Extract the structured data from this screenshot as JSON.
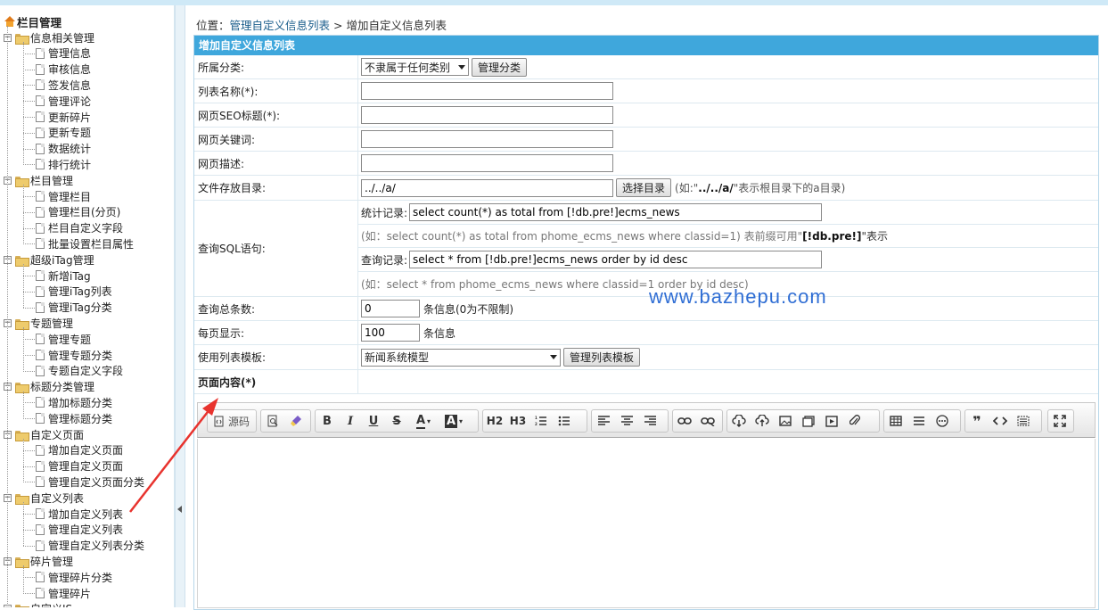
{
  "sidebar": {
    "root": "栏目管理",
    "groups": [
      {
        "label": "信息相关管理",
        "items": [
          "管理信息",
          "审核信息",
          "签发信息",
          "管理评论",
          "更新碎片",
          "更新专题",
          "数据统计",
          "排行统计"
        ]
      },
      {
        "label": "栏目管理",
        "items": [
          "管理栏目",
          "管理栏目(分页)",
          "栏目自定义字段",
          "批量设置栏目属性"
        ]
      },
      {
        "label": "超级iTag管理",
        "items": [
          "新增iTag",
          "管理iTag列表",
          "管理iTag分类"
        ]
      },
      {
        "label": "专题管理",
        "items": [
          "管理专题",
          "管理专题分类",
          "专题自定义字段"
        ]
      },
      {
        "label": "标题分类管理",
        "items": [
          "增加标题分类",
          "管理标题分类"
        ]
      },
      {
        "label": "自定义页面",
        "items": [
          "增加自定义页面",
          "管理自定义页面",
          "管理自定义页面分类"
        ]
      },
      {
        "label": "自定义列表",
        "items": [
          "增加自定义列表",
          "管理自定义列表",
          "管理自定义列表分类"
        ]
      },
      {
        "label": "碎片管理",
        "items": [
          "管理碎片分类",
          "管理碎片"
        ]
      }
    ],
    "cut_label": "自定义JS"
  },
  "breadcrumb": {
    "prefix": "位置：",
    "link": "管理自定义信息列表",
    "sep": " > ",
    "current": "增加自定义信息列表"
  },
  "panel_title": "增加自定义信息列表",
  "form": {
    "category": {
      "label": "所属分类:",
      "value": "不隶属于任何类别",
      "button": "管理分类"
    },
    "list_name": {
      "label": "列表名称(*):",
      "value": ""
    },
    "seo_title": {
      "label": "网页SEO标题(*):",
      "value": ""
    },
    "keywords": {
      "label": "网页关键词:",
      "value": ""
    },
    "description": {
      "label": "网页描述:",
      "value": ""
    },
    "dir": {
      "label": "文件存放目录:",
      "value": "../../a/",
      "button": "选择目录",
      "hint_pre": "(如:\"",
      "hint_bold": "../../a/",
      "hint_post": "\"表示根目录下的a目录)"
    },
    "sql": {
      "label": "查询SQL语句:",
      "count_label": "统计记录:",
      "count_value": "select count(*) as total from [!db.pre!]ecms_news",
      "count_hint_pre": "(如：select count(*) as total from phome_ecms_news where classid=1) 表前缀可用\"",
      "count_hint_bold": "[!db.pre!]",
      "count_hint_post": "\"表示",
      "query_label": "查询记录:",
      "query_value": "select * from [!db.pre!]ecms_news order by id desc",
      "query_hint": "(如：select * from phome_ecms_news where classid=1 order by id desc)"
    },
    "total": {
      "label": "查询总条数:",
      "value": "0",
      "suffix": "条信息(0为不限制)"
    },
    "per_page": {
      "label": "每页显示:",
      "value": "100",
      "suffix": "条信息"
    },
    "template": {
      "label": "使用列表模板:",
      "value": "新闻系统模型",
      "button": "管理列表模板"
    },
    "content": {
      "label": "页面内容(*)"
    }
  },
  "editor_toolbar": {
    "source": "源码",
    "buttons": [
      "H2",
      "H3"
    ]
  },
  "watermark": "www.bazhepu.com",
  "colors": {
    "header": "#3fa7dc",
    "arrow": "#e8332e",
    "link": "#1b5e8c"
  }
}
